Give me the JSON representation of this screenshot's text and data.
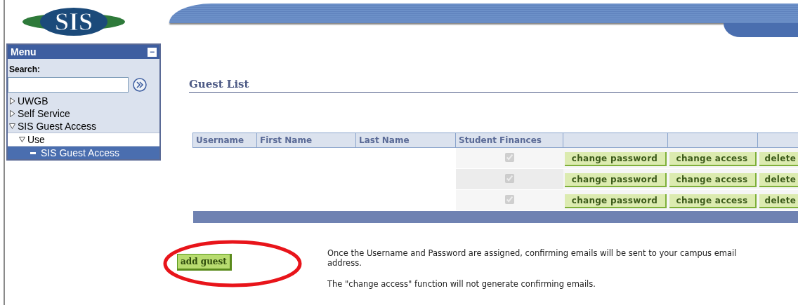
{
  "logo": {
    "text": "SIS"
  },
  "menu": {
    "title": "Menu",
    "collapse_icon": "−",
    "search_label": "Search:",
    "items": [
      {
        "label": "UWGB",
        "expanded": false,
        "selected": false
      },
      {
        "label": "Self Service",
        "expanded": false,
        "selected": false
      },
      {
        "label": "SIS Guest Access",
        "expanded": true,
        "selected": false,
        "children": [
          {
            "label": "Use",
            "expanded": true,
            "selected": false,
            "children": [
              {
                "label": "SIS Guest Access",
                "selected": true
              }
            ]
          }
        ]
      }
    ]
  },
  "page": {
    "title": "Guest List"
  },
  "table": {
    "columns": [
      "Username",
      "First Name",
      "Last Name",
      "Student Finances"
    ],
    "rows": [
      {
        "student_finances": true,
        "actions": [
          "change password",
          "change access",
          "delete"
        ]
      },
      {
        "student_finances": true,
        "actions": [
          "change password",
          "change access",
          "delete"
        ]
      },
      {
        "student_finances": true,
        "actions": [
          "change password",
          "change access",
          "delete"
        ]
      }
    ]
  },
  "add_button": {
    "label": "add guest"
  },
  "annotation": {
    "color": "#e8141a"
  },
  "notes": [
    "Once the Username and Password are assigned, confirming emails will be sent to your campus email address.",
    "The \"change access\" function will not generate confirming emails."
  ]
}
